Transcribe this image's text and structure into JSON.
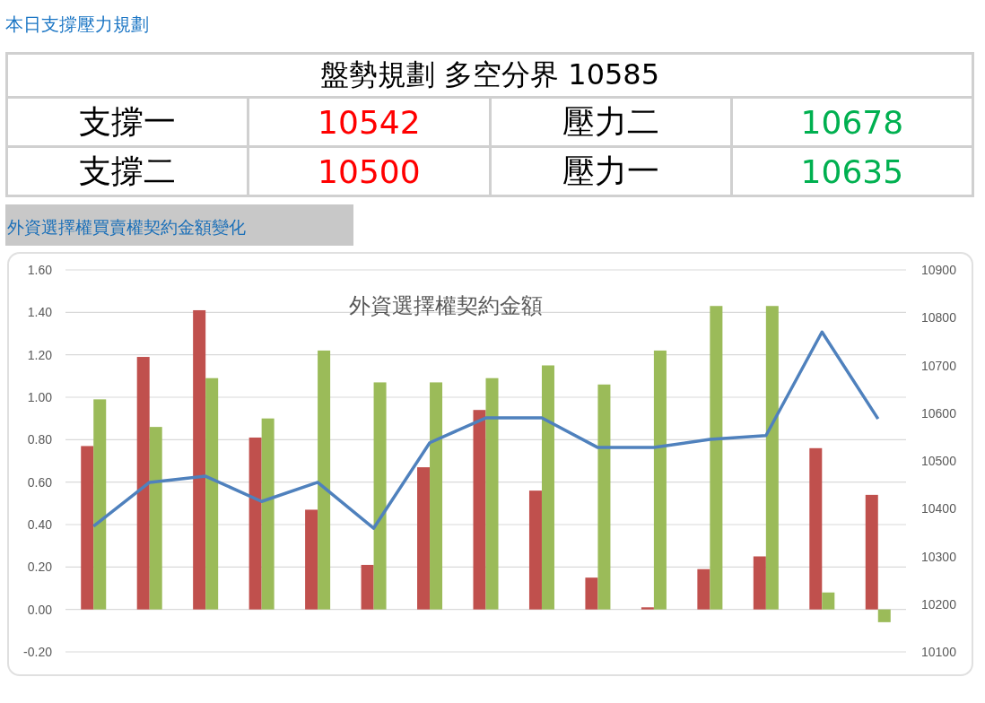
{
  "page_title": "本日支撐壓力規劃",
  "plan_table": {
    "header": "盤勢規劃 多空分界 10585",
    "rows": [
      {
        "cells": [
          {
            "text": "支撐一",
            "kind": "label"
          },
          {
            "text": "10542",
            "kind": "support"
          },
          {
            "text": "壓力二",
            "kind": "label"
          },
          {
            "text": "10678",
            "kind": "resistance"
          }
        ]
      },
      {
        "cells": [
          {
            "text": "支撐二",
            "kind": "label"
          },
          {
            "text": "10500",
            "kind": "support"
          },
          {
            "text": "壓力一",
            "kind": "label"
          },
          {
            "text": "10635",
            "kind": "resistance"
          }
        ]
      }
    ]
  },
  "section_title": "外資選擇權買賣權契約金額變化",
  "chart": {
    "bar_layer": {
      "chart_data": {
        "type": "bar",
        "title": "外資選擇權契約金額",
        "grid": true,
        "ylim": [
          -0.2,
          1.6
        ],
        "yticks": [
          {
            "value": 1.6,
            "label": "1.60"
          },
          {
            "value": 1.4,
            "label": "1.40"
          },
          {
            "value": 1.2,
            "label": "1.20"
          },
          {
            "value": 1.0,
            "label": "1.00"
          },
          {
            "value": 0.8,
            "label": "0.80"
          },
          {
            "value": 0.6,
            "label": "0.60"
          },
          {
            "value": 0.4,
            "label": "0.40"
          },
          {
            "value": 0.2,
            "label": "0.20"
          },
          {
            "value": 0,
            "label": "0.00"
          },
          {
            "value": -0.2,
            "label": "-0.20"
          }
        ],
        "series": [
          {
            "color": "#c0504d",
            "values": [
              0.77,
              1.19,
              1.41,
              0.81,
              0.47,
              0.21,
              0.67,
              0.94,
              0.56,
              0.15,
              0.01,
              0.19,
              0.25,
              0.76,
              0.54
            ]
          },
          {
            "color": "#9bbb59",
            "values": [
              0.99,
              0.86,
              1.09,
              0.9,
              1.22,
              1.07,
              1.07,
              1.09,
              1.15,
              1.06,
              1.22,
              1.43,
              1.43,
              0.08,
              -0.06
            ]
          }
        ]
      }
    },
    "line_layer": {
      "chart_data": {
        "type": "line",
        "ylim": [
          10100,
          10900
        ],
        "yticks": [
          10900,
          10800,
          10700,
          10600,
          10500,
          10400,
          10300,
          10200,
          10100
        ],
        "series": [
          {
            "color": "#4f81bd",
            "values": [
              10363,
              10455,
              10468,
              10415,
              10455,
              10359,
              10538,
              10590,
              10590,
              10528,
              10528,
              10545,
              10553,
              10770,
              10588
            ]
          }
        ]
      }
    }
  }
}
